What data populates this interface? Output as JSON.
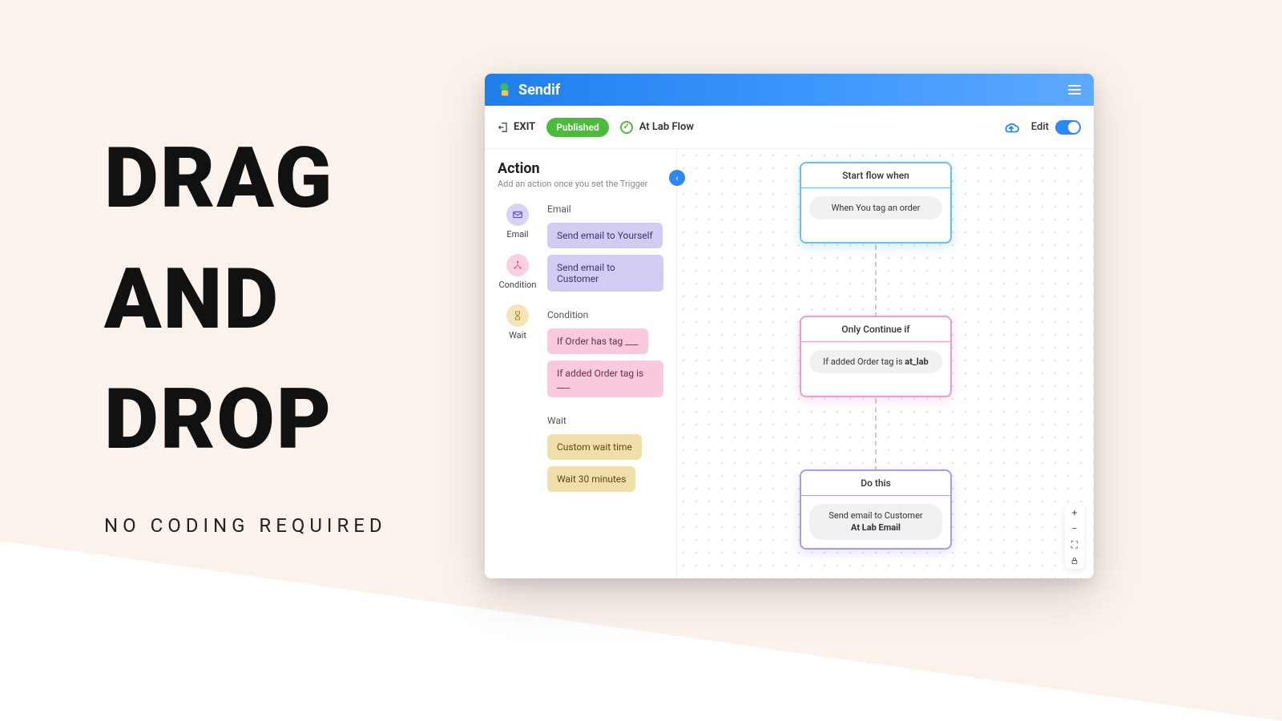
{
  "marketing": {
    "line1": "DRAG",
    "line2": "AND",
    "line3": "DROP",
    "sub": "NO CODING REQUIRED"
  },
  "app": {
    "brand": "Sendif",
    "toolbar": {
      "exit": "EXIT",
      "status": "Published",
      "flow_name": "At Lab Flow",
      "edit_label": "Edit"
    },
    "panel": {
      "title": "Action",
      "subtitle": "Add an action once you set the Trigger",
      "categories": {
        "email": {
          "label": "Email"
        },
        "condition": {
          "label": "Condition"
        },
        "wait": {
          "label": "Wait"
        }
      },
      "sections": {
        "email": {
          "heading": "Email",
          "items": [
            "Send email to Yourself",
            "Send email to Customer"
          ]
        },
        "condition": {
          "heading": "Condition",
          "items": [
            "If Order has tag ___",
            "If added Order tag is ___"
          ]
        },
        "wait": {
          "heading": "Wait",
          "items": [
            "Custom wait time",
            "Wait 30 minutes"
          ]
        }
      }
    },
    "nodes": {
      "trigger": {
        "header": "Start flow when",
        "pill": "When You tag an order"
      },
      "condition": {
        "header": "Only Continue if",
        "pill_prefix": "If added Order tag is ",
        "pill_bold": "at_lab"
      },
      "action": {
        "header": "Do this",
        "pill_line1": "Send email to Customer",
        "pill_line2": "At Lab Email"
      }
    }
  }
}
